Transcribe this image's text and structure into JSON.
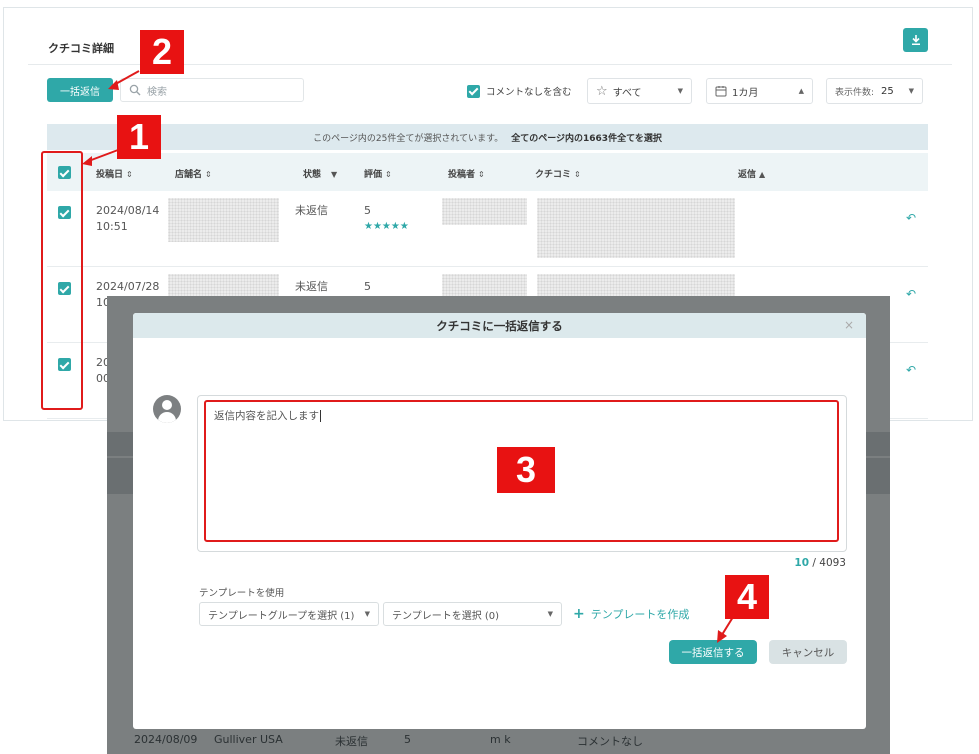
{
  "card": {
    "title": "クチコミ詳細"
  },
  "toolbar": {
    "bulk_reply_label": "一括返信",
    "search_placeholder": "検索",
    "include_no_comment_label": "コメントなしを含む",
    "star_filter_value": "すべて",
    "period_filter_value": "1カ月",
    "per_page_label": "表示件数:",
    "per_page_value": "25"
  },
  "selection_banner": {
    "text": "このページ内の25件全てが選択されています。",
    "select_all_link": "全てのページ内の1663件全てを選択"
  },
  "table": {
    "headers": {
      "date": "投稿日",
      "store": "店舗名",
      "status": "状態",
      "rating": "評価",
      "author": "投稿者",
      "review": "クチコミ",
      "reply": "返信"
    },
    "rows": [
      {
        "date": "2024/08/14",
        "time": "10:51",
        "status": "未返信",
        "rating": "5",
        "stars": "★★★★★"
      },
      {
        "date": "2024/07/28",
        "time": "10",
        "status": "未返信",
        "rating": "5"
      },
      {
        "date": "20",
        "time": "00"
      }
    ],
    "ghost_row": {
      "date": "2024/08/09",
      "store": "Gulliver USA",
      "status": "未返信",
      "rating": "5",
      "author": "m k",
      "review": "コメントなし"
    }
  },
  "modal": {
    "title": "クチコミに一括返信する",
    "close": "×",
    "reply_placeholder": "返信内容を記入します",
    "char_count_current": "10",
    "char_count_sep": " / ",
    "char_count_max": "4093",
    "template_label": "テンプレートを使用",
    "template_group_select": "テンプレートグループを選択 (1)",
    "template_select": "テンプレートを選択 (0)",
    "create_template_label": "テンプレートを作成",
    "submit_label": "一括返信する",
    "cancel_label": "キャンセル"
  },
  "annotations": {
    "step1": "1",
    "step2": "2",
    "step3": "3",
    "step4": "4"
  },
  "colors": {
    "accent": "#2fa8a8",
    "annotation_red": "#e01b1b"
  },
  "icons": [
    "download-icon",
    "search-icon",
    "star-outline-icon",
    "calendar-icon",
    "reply-icon",
    "user-avatar-icon",
    "close-icon"
  ]
}
